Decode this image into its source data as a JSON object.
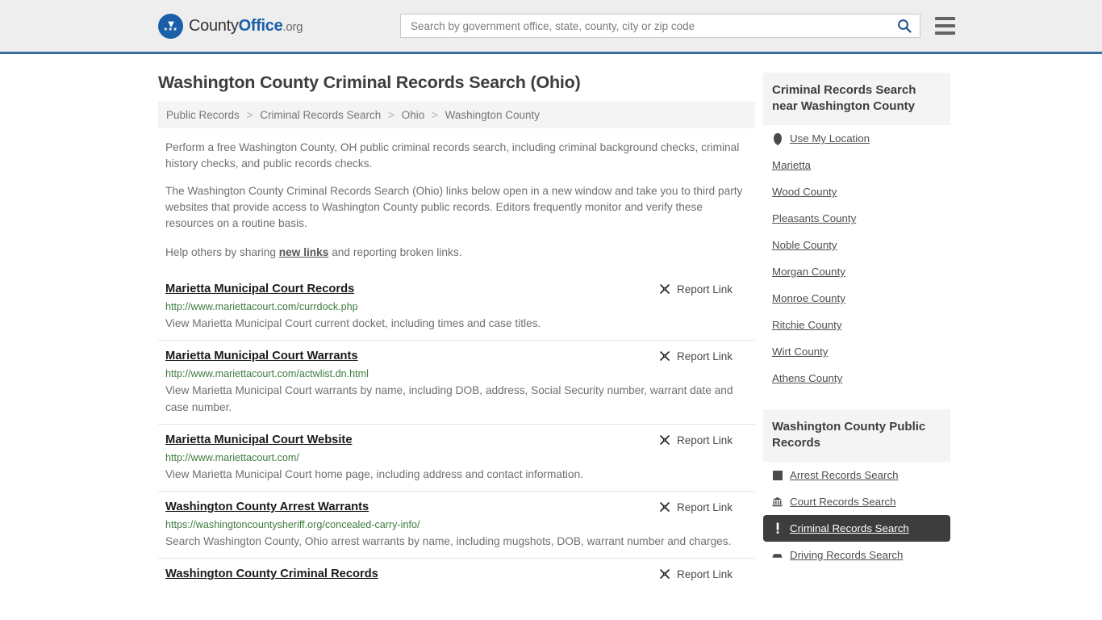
{
  "header": {
    "logo": {
      "part1": "County",
      "part2": "Office",
      "part3": ".org",
      "icon": "eagle-crest-icon"
    },
    "search": {
      "placeholder": "Search by government office, state, county, city or zip code",
      "value": ""
    },
    "search_icon": "search-icon",
    "menu_icon": "hamburger-menu-icon"
  },
  "main": {
    "title": "Washington County Criminal Records Search (Ohio)",
    "breadcrumb": [
      "Public Records",
      "Criminal Records Search",
      "Ohio",
      "Washington County"
    ],
    "breadcrumb_separator": ">",
    "intro": [
      "Perform a free Washington County, OH public criminal records search, including criminal background checks, criminal history checks, and public records checks.",
      "The Washington County Criminal Records Search (Ohio) links below open in a new window and take you to third party websites that provide access to Washington County public records. Editors frequently monitor and verify these resources on a routine basis."
    ],
    "help_prefix": "Help others by sharing ",
    "help_link": "new links",
    "help_suffix": " and reporting broken links.",
    "report_label": "Report Link",
    "report_icon": "broken-link-icon",
    "results": [
      {
        "title": "Marietta Municipal Court Records",
        "url": "http://www.mariettacourt.com/currdock.php",
        "desc": "View Marietta Municipal Court current docket, including times and case titles."
      },
      {
        "title": "Marietta Municipal Court Warrants",
        "url": "http://www.mariettacourt.com/actwlist.dn.html",
        "desc": "View Marietta Municipal Court warrants by name, including DOB, address, Social Security number, warrant date and case number."
      },
      {
        "title": "Marietta Municipal Court Website",
        "url": "http://www.mariettacourt.com/",
        "desc": "View Marietta Municipal Court home page, including address and contact information."
      },
      {
        "title": "Washington County Arrest Warrants",
        "url": "https://washingtoncountysheriff.org/concealed-carry-info/",
        "desc": "Search Washington County, Ohio arrest warrants by name, including mugshots, DOB, warrant number and charges."
      },
      {
        "title": "Washington County Criminal Records",
        "url": "",
        "desc": ""
      }
    ]
  },
  "sidebar": {
    "nearby": {
      "title": "Criminal Records Search near Washington County",
      "items": [
        {
          "label": "Use My Location",
          "icon": "map-pin-icon"
        },
        {
          "label": "Marietta",
          "icon": ""
        },
        {
          "label": "Wood County",
          "icon": ""
        },
        {
          "label": "Pleasants County",
          "icon": ""
        },
        {
          "label": "Noble County",
          "icon": ""
        },
        {
          "label": "Morgan County",
          "icon": ""
        },
        {
          "label": "Monroe County",
          "icon": ""
        },
        {
          "label": "Ritchie County",
          "icon": ""
        },
        {
          "label": "Wirt County",
          "icon": ""
        },
        {
          "label": "Athens County",
          "icon": ""
        }
      ]
    },
    "public_records": {
      "title": "Washington County Public Records",
      "items": [
        {
          "label": "Arrest Records Search",
          "icon": "fingerprint-icon",
          "active": false
        },
        {
          "label": "Court Records Search",
          "icon": "courthouse-icon",
          "active": false
        },
        {
          "label": "Criminal Records Search",
          "icon": "exclamation-icon",
          "active": true
        },
        {
          "label": "Driving Records Search",
          "icon": "car-icon",
          "active": false
        }
      ]
    }
  },
  "colors": {
    "brand_blue": "#1a5fa8",
    "header_border": "#3b6fa0",
    "header_bg": "#eeeeee",
    "url_green": "#3f7b3f",
    "active_bg": "#3d3d3d"
  }
}
